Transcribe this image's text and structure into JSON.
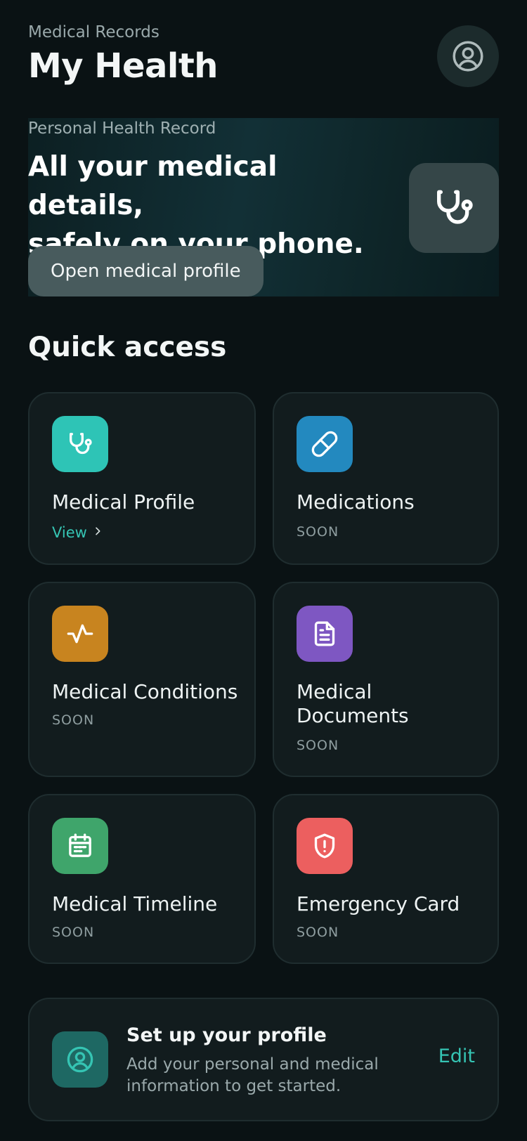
{
  "header": {
    "subtitle": "Medical Records",
    "title": "My Health",
    "profile_icon": "user-circle-icon"
  },
  "hero": {
    "eyebrow": "Personal Health Record",
    "title": "All your medical details,\nsafely on your phone.",
    "button_label": "Open medical profile",
    "icon": "stethoscope-icon"
  },
  "quick_access": {
    "title": "Quick access",
    "cards": [
      {
        "title": "Medical Profile",
        "link": "View",
        "status": "",
        "icon": "stethoscope-icon",
        "color": "#2ec4b6"
      },
      {
        "title": "Medications",
        "status": "SOON",
        "icon": "pill-icon",
        "color": "#2389bf"
      },
      {
        "title": "Medical Conditions",
        "status": "SOON",
        "icon": "pulse-icon",
        "color": "#c8841f"
      },
      {
        "title": "Medical\nDocuments",
        "status": "SOON",
        "icon": "document-icon",
        "color": "#7e57c2"
      },
      {
        "title": "Medical Timeline",
        "status": "SOON",
        "icon": "calendar-icon",
        "color": "#3fa56b"
      },
      {
        "title": "Emergency Card",
        "status": "SOON",
        "icon": "shield-alert-icon",
        "color": "#ec5f5f"
      }
    ]
  },
  "setup": {
    "title": "Set up your profile",
    "description": "Add your personal and medical\ninformation to get started.",
    "edit_label": "Edit",
    "icon": "user-circle-icon"
  },
  "colors": {
    "background": "#0a1214",
    "card": "#121c1e",
    "accent": "#35c4b3"
  }
}
